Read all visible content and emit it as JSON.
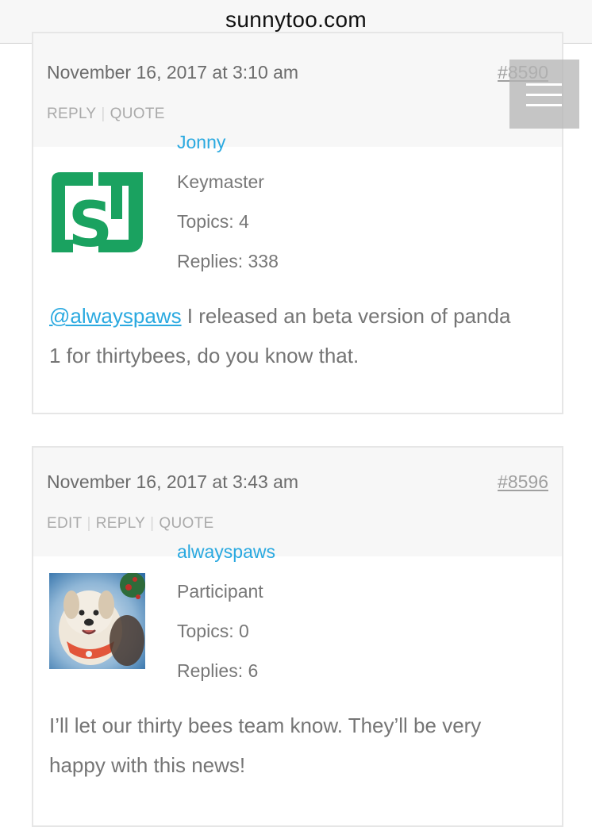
{
  "browser": {
    "url": "sunnytoo.com"
  },
  "posts": [
    {
      "date": "November 16, 2017 at 3:10 am",
      "permalink": "#8590",
      "actions": [
        "REPLY",
        "QUOTE"
      ],
      "author": {
        "name": "Jonny",
        "role": "Keymaster",
        "topics": "Topics: 4",
        "replies": "Replies: 338"
      },
      "mention": "@alwayspaws",
      "text_line1": " I released an beta version of panda",
      "text_line2": "1 for thirtybees, do you know that."
    },
    {
      "date": "November 16, 2017 at 3:43 am",
      "permalink": "#8596",
      "actions": [
        "EDIT",
        "REPLY",
        "QUOTE"
      ],
      "author": {
        "name": "alwayspaws",
        "role": "Participant",
        "topics": "Topics: 0",
        "replies": "Replies: 6"
      },
      "text_line1": "I’ll let our thirty bees team know. They’ll be very",
      "text_line2": "happy with this news!"
    }
  ],
  "colors": {
    "link": "#2aa9e0",
    "logo_green": "#1aa260",
    "header_bg": "#f7f7f7"
  },
  "icons": {
    "menu": "hamburger-menu-icon",
    "avatar1": "st-logo-avatar",
    "avatar2": "dog-photo-avatar"
  }
}
